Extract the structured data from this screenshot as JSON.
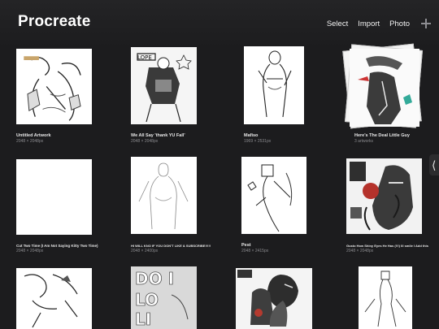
{
  "header": {
    "title": "Procreate",
    "select_label": "Select",
    "import_label": "Import",
    "photo_label": "Photo",
    "add_icon": "plus-icon"
  },
  "gallery": [
    {
      "name": "Untitled Artwork",
      "dims": "2048 × 2048px"
    },
    {
      "name": "We All Say 'thank YU Fall'",
      "dims": "2048 × 2048px"
    },
    {
      "name": "Mafiso",
      "dims": "1969 × 2531px"
    },
    {
      "name": "Here's The Deal Little Guy",
      "dims": "3 artworks"
    },
    {
      "name": "Cut Two Time (I Am Not Saying Kitty Two Time)",
      "dims": "2048 × 2048px"
    },
    {
      "name": "HI WILL KNO IF YOU DON'T LIKE & SUBSCRIBE!!!!!",
      "dims": "2048 × 2400px"
    },
    {
      "name": "Pest",
      "dims": "2048 × 2415px"
    },
    {
      "name": "Gusto How Shiny Eyes He Has (!!!) Ill smile I Add this",
      "dims": "2048 × 2048px"
    },
    {
      "name": "",
      "dims": ""
    },
    {
      "name": "",
      "dims": ""
    },
    {
      "name": "",
      "dims": ""
    },
    {
      "name": "",
      "dims": ""
    }
  ],
  "side_handle_icon": "chevron-left-icon",
  "colors": {
    "background": "#1c1c1e",
    "accent": "#ffffff",
    "muted": "#8a8a8e"
  }
}
